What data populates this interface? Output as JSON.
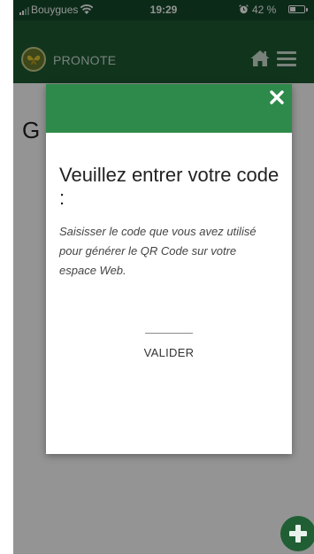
{
  "statusbar": {
    "carrier": "Bouygues",
    "time": "19:29",
    "battery_text": "42 %",
    "battery_level": 0.42,
    "icons": {
      "wifi": "wifi-icon",
      "alarm": "alarm-icon",
      "battery": "battery-icon",
      "signal": "signal-icon"
    }
  },
  "header": {
    "app_name": "PRONOTE",
    "icons": {
      "logo": "butterfly-logo-icon",
      "home": "home-icon",
      "menu": "hamburger-menu-icon"
    }
  },
  "background": {
    "heading": "G"
  },
  "modal": {
    "title": "Veuillez entrer votre code :",
    "description": "Saisisser le code que vous avez utilisé pour générer le QR Code sur votre espace Web.",
    "code_value": "",
    "validate_label": "VALIDER",
    "icons": {
      "close": "close-icon"
    }
  },
  "fab": {
    "icon": "plus-icon"
  },
  "colors": {
    "status_bar": "#134a2a",
    "app_header": "#1e5a33",
    "modal_header": "#2e8a4a",
    "fab": "#205f34"
  }
}
